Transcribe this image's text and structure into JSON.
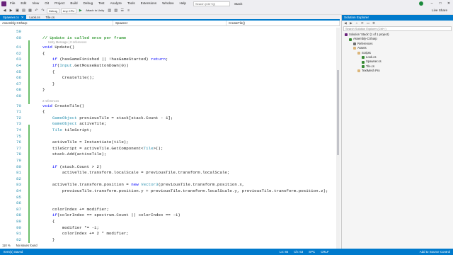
{
  "menu": {
    "items": [
      "File",
      "Edit",
      "View",
      "Git",
      "Project",
      "Build",
      "Debug",
      "Test",
      "Analyze",
      "Tools",
      "Extensions",
      "Window",
      "Help"
    ],
    "search_placeholder": "Search (Ctrl+Q)",
    "solution_name": "Stack"
  },
  "toolbar": {
    "config": "Debug",
    "platform": "Any CPU",
    "attach": "Attach to Unity",
    "live_share": "Live Share"
  },
  "tabs": [
    {
      "label": "Spawner.cs"
    },
    {
      "label": "Look.cs"
    },
    {
      "label": "Tile.cs"
    }
  ],
  "navbar": {
    "project": "Assembly-CSharp",
    "class": "Spawner",
    "member": "CreateTile()"
  },
  "code": [
    {
      "num": "59",
      "text": ""
    },
    {
      "num": "60",
      "text": "// Update is called once per frame",
      "cls": "cm"
    },
    {
      "num": "61",
      "text": "void Update()"
    },
    {
      "num": "62",
      "text": "{"
    },
    {
      "num": "63",
      "text": "    if (hasGameFinished || !hasGameStarted) return;"
    },
    {
      "num": "64",
      "text": "    if(Input.GetMouseButtonDown(0))"
    },
    {
      "num": "65",
      "text": "    {"
    },
    {
      "num": "66",
      "text": "        CreateTile();"
    },
    {
      "num": "67",
      "text": "    }"
    },
    {
      "num": "68",
      "text": "}"
    },
    {
      "num": "69",
      "text": ""
    },
    {
      "num": "70",
      "text": "void CreateTile()"
    },
    {
      "num": "71",
      "text": "{"
    },
    {
      "num": "72",
      "text": "    GameObject previousTile = stack[stack.Count - 1];"
    },
    {
      "num": "73",
      "text": "    GameObject activeTile;"
    },
    {
      "num": "74",
      "text": "    Tile tileScript;"
    },
    {
      "num": "75",
      "text": ""
    },
    {
      "num": "76",
      "text": "    activeTile = Instantiate(tile);"
    },
    {
      "num": "77",
      "text": "    tileScript = activeTile.GetComponent<Tile>();"
    },
    {
      "num": "78",
      "text": "    stack.Add(activeTile);"
    },
    {
      "num": "79",
      "text": ""
    },
    {
      "num": "80",
      "text": "    if (stack.Count > 2)"
    },
    {
      "num": "81",
      "text": "        activeTile.transform.localScale = previousTile.transform.localScale;"
    },
    {
      "num": "82",
      "text": ""
    },
    {
      "num": "83",
      "text": "    activeTile.transform.position = new Vector3(previousTile.transform.position.x,"
    },
    {
      "num": "84",
      "text": "        previousTile.transform.position.y + previousTile.transform.localScale.y, previousTile.transform.position.z);"
    },
    {
      "num": "85",
      "text": ""
    },
    {
      "num": "86",
      "text": ""
    },
    {
      "num": "87",
      "text": "    colorIndex += modifier;"
    },
    {
      "num": "88",
      "text": "    if(colorIndex == spectrum.Count || colorIndex == -1)"
    },
    {
      "num": "89",
      "text": "    {"
    },
    {
      "num": "90",
      "text": "        modifier *= -1;"
    },
    {
      "num": "91",
      "text": "        colorIndex += 2 * modifier;"
    },
    {
      "num": "92",
      "text": "    }"
    }
  ],
  "hints": {
    "update": "Unity Message | 0 references",
    "create": "2 references"
  },
  "solution_explorer": {
    "title": "Solution Explorer",
    "search_placeholder": "Search Solution Explorer (Ctrl+;)",
    "nodes": [
      {
        "label": "Solution 'Stack' (1 of 1 project)",
        "indent": 0,
        "icon": "sol"
      },
      {
        "label": "Assembly-CSharp",
        "indent": 1,
        "icon": "proj"
      },
      {
        "label": "References",
        "indent": 2,
        "icon": "ref"
      },
      {
        "label": "Assets",
        "indent": 2,
        "icon": "fold"
      },
      {
        "label": "Scripts",
        "indent": 3,
        "icon": "fold"
      },
      {
        "label": "Look.cs",
        "indent": 4,
        "icon": "cs"
      },
      {
        "label": "Spawner.cs",
        "indent": 4,
        "icon": "cs"
      },
      {
        "label": "Tile.cs",
        "indent": 4,
        "icon": "cs"
      },
      {
        "label": "TextMesh Pro",
        "indent": 3,
        "icon": "fold"
      }
    ]
  },
  "status": {
    "left": "Item(s) Saved",
    "zoom": "110 %",
    "issues": "No issues found",
    "ln": "Ln: 84",
    "ch": "Ch: 63",
    "spc": "SPC",
    "crlf": "CRLF",
    "source_control": "Add to Source Control"
  }
}
